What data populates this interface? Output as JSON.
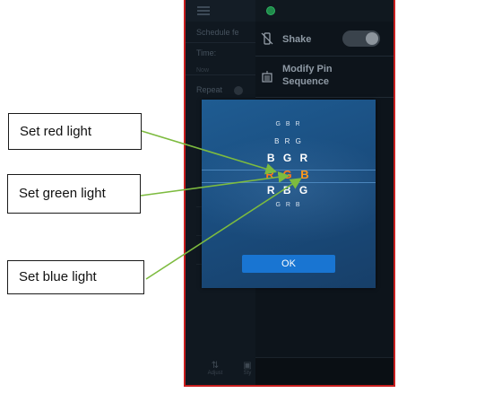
{
  "app": {
    "schedule_label": "Schedule fe",
    "time_label": "Time:",
    "time_sub": "Now",
    "repeat_label": "Repeat"
  },
  "menu": {
    "shake_label": "Shake",
    "shake_enabled": false,
    "modify_pin_line1": "Modify Pin",
    "modify_pin_line2": "Sequence"
  },
  "nav": {
    "items": [
      {
        "label": "Adjust",
        "icon": "sliders-icon"
      },
      {
        "label": "Sty",
        "icon": "grid-icon"
      }
    ]
  },
  "dialog": {
    "options": [
      "GBR",
      "BRG",
      "BGR",
      "RGB",
      "RBG",
      "GRB"
    ],
    "selected_index": 3,
    "selected_letters": [
      "R",
      "G",
      "B"
    ],
    "selected_colors": [
      "#ff7a1a",
      "#ff7a1a",
      "#ff9a1a"
    ],
    "ok_label": "OK"
  },
  "callouts": {
    "red": "Set red light",
    "green": "Set green light",
    "blue": "Set blue light"
  },
  "colors": {
    "arrow": "#7dbb3f",
    "frame": "#c81e1e",
    "ok_button": "#1975d2"
  }
}
